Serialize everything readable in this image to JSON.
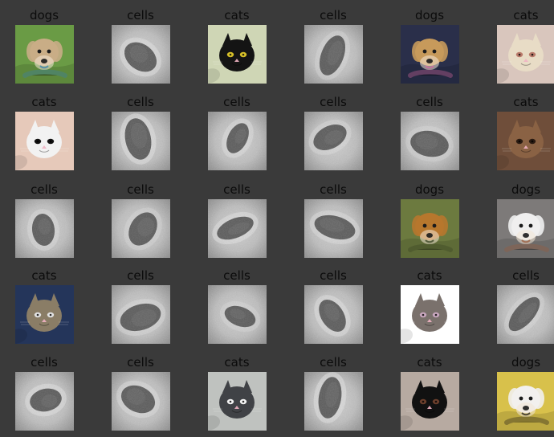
{
  "grid": {
    "rows": 5,
    "cols": 6,
    "tiles": [
      {
        "label": "dogs",
        "kind": "dog-photo",
        "bg": "#6a9b45",
        "subject": "#c9ad86",
        "accent": "#3a7fb0",
        "icon": "dog-image-icon"
      },
      {
        "label": "cells",
        "kind": "cell-micrograph",
        "icon": "cell-image-icon"
      },
      {
        "label": "cats",
        "kind": "cat-photo",
        "bg": "#cfd6b5",
        "subject": "#141414",
        "accent": "#d8c12a",
        "icon": "cat-image-icon"
      },
      {
        "label": "cells",
        "kind": "cell-micrograph",
        "icon": "cell-image-icon"
      },
      {
        "label": "dogs",
        "kind": "dog-photo",
        "bg": "#2a2f4a",
        "subject": "#c79a5b",
        "accent": "#d86aa0",
        "icon": "dog-image-icon"
      },
      {
        "label": "cats",
        "kind": "cat-photo",
        "bg": "#d9c6bd",
        "subject": "#e8dcc6",
        "accent": "#b97a6b",
        "icon": "cat-image-icon"
      },
      {
        "label": "cats",
        "kind": "cat-photo",
        "bg": "#e6c9ba",
        "subject": "#f2f2f2",
        "accent": "#111111",
        "icon": "cat-image-icon"
      },
      {
        "label": "cells",
        "kind": "cell-micrograph",
        "icon": "cell-image-icon"
      },
      {
        "label": "cells",
        "kind": "cell-micrograph",
        "icon": "cell-image-icon"
      },
      {
        "label": "cells",
        "kind": "cell-micrograph",
        "icon": "cell-image-icon"
      },
      {
        "label": "cells",
        "kind": "cell-micrograph",
        "icon": "cell-image-icon"
      },
      {
        "label": "cats",
        "kind": "cat-photo",
        "bg": "#6f4e3a",
        "subject": "#8a6244",
        "accent": "#2a1b12",
        "icon": "cat-image-icon"
      },
      {
        "label": "cells",
        "kind": "cell-micrograph",
        "icon": "cell-image-icon"
      },
      {
        "label": "cells",
        "kind": "cell-micrograph",
        "icon": "cell-image-icon"
      },
      {
        "label": "cells",
        "kind": "cell-micrograph",
        "icon": "cell-image-icon"
      },
      {
        "label": "cells",
        "kind": "cell-micrograph",
        "icon": "cell-image-icon"
      },
      {
        "label": "dogs",
        "kind": "dog-photo",
        "bg": "#6c7a3f",
        "subject": "#b7772d",
        "accent": "#374122",
        "icon": "dog-image-icon"
      },
      {
        "label": "dogs",
        "kind": "dog-photo",
        "bg": "#7d7a79",
        "subject": "#f0efef",
        "accent": "#9b5b3b",
        "icon": "dog-image-icon"
      },
      {
        "label": "cats",
        "kind": "cat-photo",
        "bg": "#24355a",
        "subject": "#8a7d66",
        "accent": "#e2e2e2",
        "icon": "cat-image-icon"
      },
      {
        "label": "cells",
        "kind": "cell-micrograph",
        "icon": "cell-image-icon"
      },
      {
        "label": "cells",
        "kind": "cell-micrograph",
        "icon": "cell-image-icon"
      },
      {
        "label": "cells",
        "kind": "cell-micrograph",
        "icon": "cell-image-icon"
      },
      {
        "label": "cats",
        "kind": "cat-photo",
        "bg": "#ffffff",
        "subject": "#7a716c",
        "accent": "#c9a7bf",
        "icon": "cat-image-icon"
      },
      {
        "label": "cells",
        "kind": "cell-micrograph",
        "icon": "cell-image-icon"
      },
      {
        "label": "cells",
        "kind": "cell-micrograph",
        "icon": "cell-image-icon"
      },
      {
        "label": "cells",
        "kind": "cell-micrograph",
        "icon": "cell-image-icon"
      },
      {
        "label": "cats",
        "kind": "cat-photo",
        "bg": "#bfc2bf",
        "subject": "#404246",
        "accent": "#f3f3f3",
        "icon": "cat-image-icon"
      },
      {
        "label": "cells",
        "kind": "cell-micrograph",
        "icon": "cell-image-icon"
      },
      {
        "label": "cats",
        "kind": "cat-photo",
        "bg": "#b7aaa1",
        "subject": "#111111",
        "accent": "#6b3f2c",
        "icon": "cat-image-icon"
      },
      {
        "label": "dogs",
        "kind": "dog-photo",
        "bg": "#d8c14b",
        "subject": "#f2f0ee",
        "accent": "#1e1a17",
        "icon": "dog-image-icon"
      }
    ]
  }
}
